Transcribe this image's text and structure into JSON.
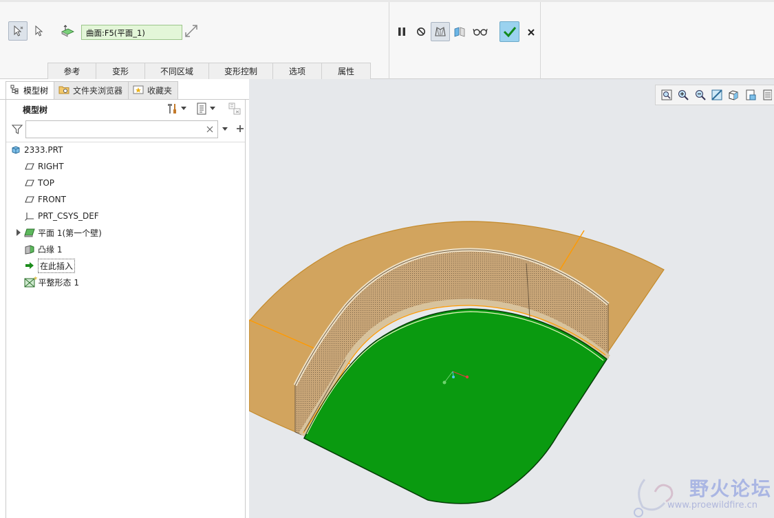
{
  "dashboard": {
    "surface_collector_value": "曲面:F5(平面_1)",
    "tabs": [
      {
        "label": "参考"
      },
      {
        "label": "变形"
      },
      {
        "label": "不同区域"
      },
      {
        "label": "变形控制"
      },
      {
        "label": "选项"
      },
      {
        "label": "属性"
      }
    ],
    "icons": {
      "select_geometry": "pick-arrow-active-icon",
      "select_plain": "pick-arrow-icon",
      "surface": "surface-sheet-icon",
      "flip": "flip-direction-icon",
      "pause": "pause-icon",
      "no_preview": "no-preview-icon",
      "preview": "geometry-preview-icon",
      "verify": "verify-icon",
      "glasses": "glasses-preview-icon",
      "ok": "checkmark-icon",
      "cancel": "close-icon"
    },
    "colors": {
      "ok_button": "#9bd2ef",
      "collector_bg": "#e3f6d8"
    }
  },
  "navigator": {
    "tabs": [
      {
        "label": "模型树",
        "icon": "model-tree-icon"
      },
      {
        "label": "文件夹浏览器",
        "icon": "folder-browser-icon"
      },
      {
        "label": "收藏夹",
        "icon": "favorites-icon"
      }
    ],
    "tree_title": "模型树",
    "search": {
      "value": "",
      "placeholder": ""
    },
    "nodes": [
      {
        "label": "2333.PRT",
        "icon": "part-icon"
      },
      {
        "label": "RIGHT",
        "icon": "datum-plane-icon"
      },
      {
        "label": "TOP",
        "icon": "datum-plane-icon"
      },
      {
        "label": "FRONT",
        "icon": "datum-plane-icon"
      },
      {
        "label": "PRT_CSYS_DEF",
        "icon": "coordinate-system-icon"
      },
      {
        "label": "平面 1(第一个壁)",
        "icon": "planar-wall-icon"
      },
      {
        "label": "凸缘 1",
        "icon": "flange-icon"
      },
      {
        "label": "在此插入",
        "icon": "insert-here-arrow-icon"
      },
      {
        "label": "平整形态 1",
        "icon": "flat-state-icon"
      }
    ]
  },
  "graphics": {
    "colors": {
      "background": "#e6e8eb",
      "base_face": "#0a9a10",
      "wall_face": "#c9a678",
      "flange_face": "#d2a45e",
      "edge_highlight": "#ff9a00"
    },
    "watermark": {
      "title": "野火论坛",
      "url": "www.proewildfire.cn"
    }
  }
}
